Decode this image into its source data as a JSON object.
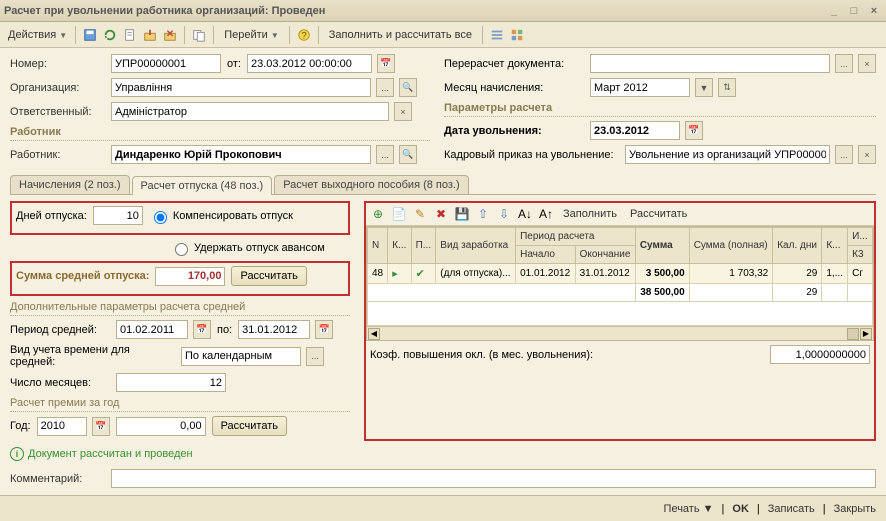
{
  "window": {
    "title": "Расчет при увольнении работника организаций: Проведен"
  },
  "menu": {
    "actions": "Действия",
    "goto": "Перейти",
    "fill_calc_all": "Заполнить и рассчитать все"
  },
  "header": {
    "number_label": "Номер:",
    "number": "УПР00000001",
    "from_label": "от:",
    "date": "23.03.2012 00:00:00",
    "org_label": "Организация:",
    "org": "Управління",
    "resp_label": "Ответственный:",
    "resp": "Адміністратор",
    "recalc_label": "Перерасчет документа:",
    "recalc": "",
    "month_label": "Месяц начисления:",
    "month": "Март 2012"
  },
  "params": {
    "head": "Параметры расчета",
    "dismiss_date_label": "Дата увольнения:",
    "dismiss_date": "23.03.2012",
    "order_label": "Кадровый приказ на увольнение:",
    "order": "Увольнение из организаций УПР00000001 ..."
  },
  "employee": {
    "head": "Работник",
    "label": "Работник:",
    "name": "Диндаренко Юрій Прокопович"
  },
  "tabs": {
    "t1": "Начисления (2 поз.)",
    "t2": "Расчет отпуска (48 поз.)",
    "t3": "Расчет выходного пособия (8 поз.)"
  },
  "vacation": {
    "days_label": "Дней отпуска:",
    "days": "10",
    "compensate": "Компенсировать отпуск",
    "withhold": "Удержать отпуск авансом",
    "avg_sum_label": "Сумма средней отпуска:",
    "avg_sum": "170,00",
    "calc_btn": "Рассчитать",
    "extra_head": "Дополнительные параметры расчета средней",
    "period_label": "Период средней:",
    "p_from": "01.02.2011",
    "p_to_label": "по:",
    "p_to": "31.01.2012",
    "time_type_label": "Вид учета времени для средней:",
    "time_type": "По календарным",
    "months_label": "Число месяцев:",
    "months": "12",
    "bonus_head": "Расчет премии за год",
    "year_label": "Год:",
    "year": "2010",
    "year_sum": "0,00"
  },
  "grid": {
    "toolbar": {
      "fill": "Заполнить",
      "calc": "Рассчитать"
    },
    "headers": {
      "n": "N",
      "k": "К...",
      "p": "П...",
      "earn_type": "Вид заработка",
      "period": "Период расчета",
      "start": "Начало",
      "end": "Окончание",
      "sum": "Сумма",
      "sum_full": "Сумма (полная)",
      "days": "Кал. дни",
      "k2": "К...",
      "i": "И...",
      "k3": "К3"
    },
    "rows": [
      {
        "n": "48",
        "earn": "(для отпуска)...",
        "start": "01.01.2012",
        "end": "31.01.2012",
        "sum": "3 500,00",
        "sum_full": "1 703,32",
        "days": "29",
        "k2": "1,...",
        "i": "Сг"
      }
    ],
    "totals": {
      "sum": "38 500,00",
      "days": "29"
    },
    "coef_label": "Коэф. повышения окл. (в мес. увольнения):",
    "coef": "1,0000000000"
  },
  "info": "Документ рассчитан и проведен",
  "comment_label": "Комментарий:",
  "comment": "",
  "footer": {
    "print": "Печать",
    "ok": "OK",
    "save": "Записать",
    "close": "Закрыть"
  }
}
